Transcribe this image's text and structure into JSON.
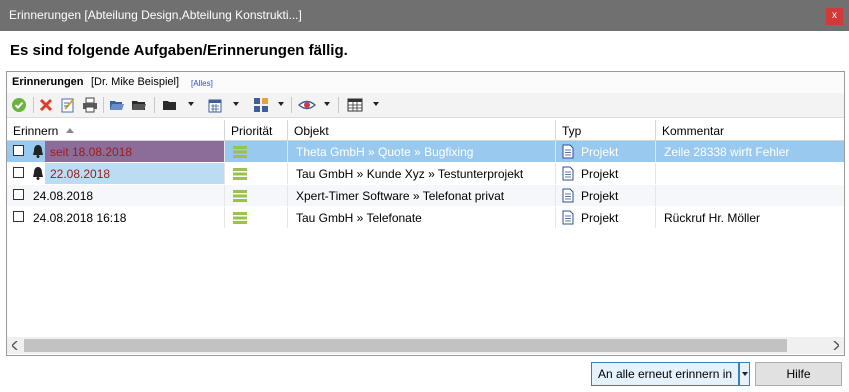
{
  "window": {
    "title": "Erinnerungen [Abteilung Design,Abteilung Konstrukti...]",
    "close_glyph": "x"
  },
  "heading": "Es sind folgende Aufgaben/Erinnerungen fällig.",
  "panel": {
    "title": "Erinnerungen",
    "user": "[Dr. Mike Beispiel]",
    "filter": "[Alles]"
  },
  "toolbar": {
    "icons": [
      "check-icon",
      "delete-icon",
      "edit-icon",
      "print-icon",
      "folder-open-icon",
      "folder-icon",
      "folder-menu-icon",
      "calendar-menu-icon",
      "view-grid-menu-icon",
      "eye-menu-icon",
      "table-menu-icon"
    ]
  },
  "columns": {
    "erinnern": "Erinnern",
    "prioritaet": "Priorität",
    "objekt": "Objekt",
    "typ": "Typ",
    "kommentar": "Kommentar"
  },
  "rows": [
    {
      "date": "seit 18.08.2018",
      "objekt": "Theta GmbH » Quote » Bugfixing",
      "typ": "Projekt",
      "kommentar": "Zeile 28338 wirft Fehler",
      "bell": true,
      "selected": true
    },
    {
      "date": "22.08.2018",
      "objekt": "Tau GmbH » Kunde Xyz » Testunterprojekt",
      "typ": "Projekt",
      "kommentar": "",
      "bell": true,
      "selected": false
    },
    {
      "date": "24.08.2018",
      "objekt": "Xpert-Timer Software » Telefonat privat",
      "typ": "Projekt",
      "kommentar": "",
      "bell": false,
      "selected": false
    },
    {
      "date": "24.08.2018 16:18",
      "objekt": "Tau GmbH » Telefonate",
      "typ": "Projekt",
      "kommentar": "Rückruf Hr. Möller",
      "bell": false,
      "selected": false
    }
  ],
  "colors": {
    "selected_row": "#99c9ef",
    "overdue_date_bg": "#8c6d9a",
    "due_date_bg": "#bcdcf4",
    "overdue_text": "#9b1b1b",
    "priority": "#9bc24e",
    "alt_row": "#f6f7fb"
  },
  "buttons": {
    "remind": "An alle erneut erinnern in",
    "help": "Hilfe"
  }
}
